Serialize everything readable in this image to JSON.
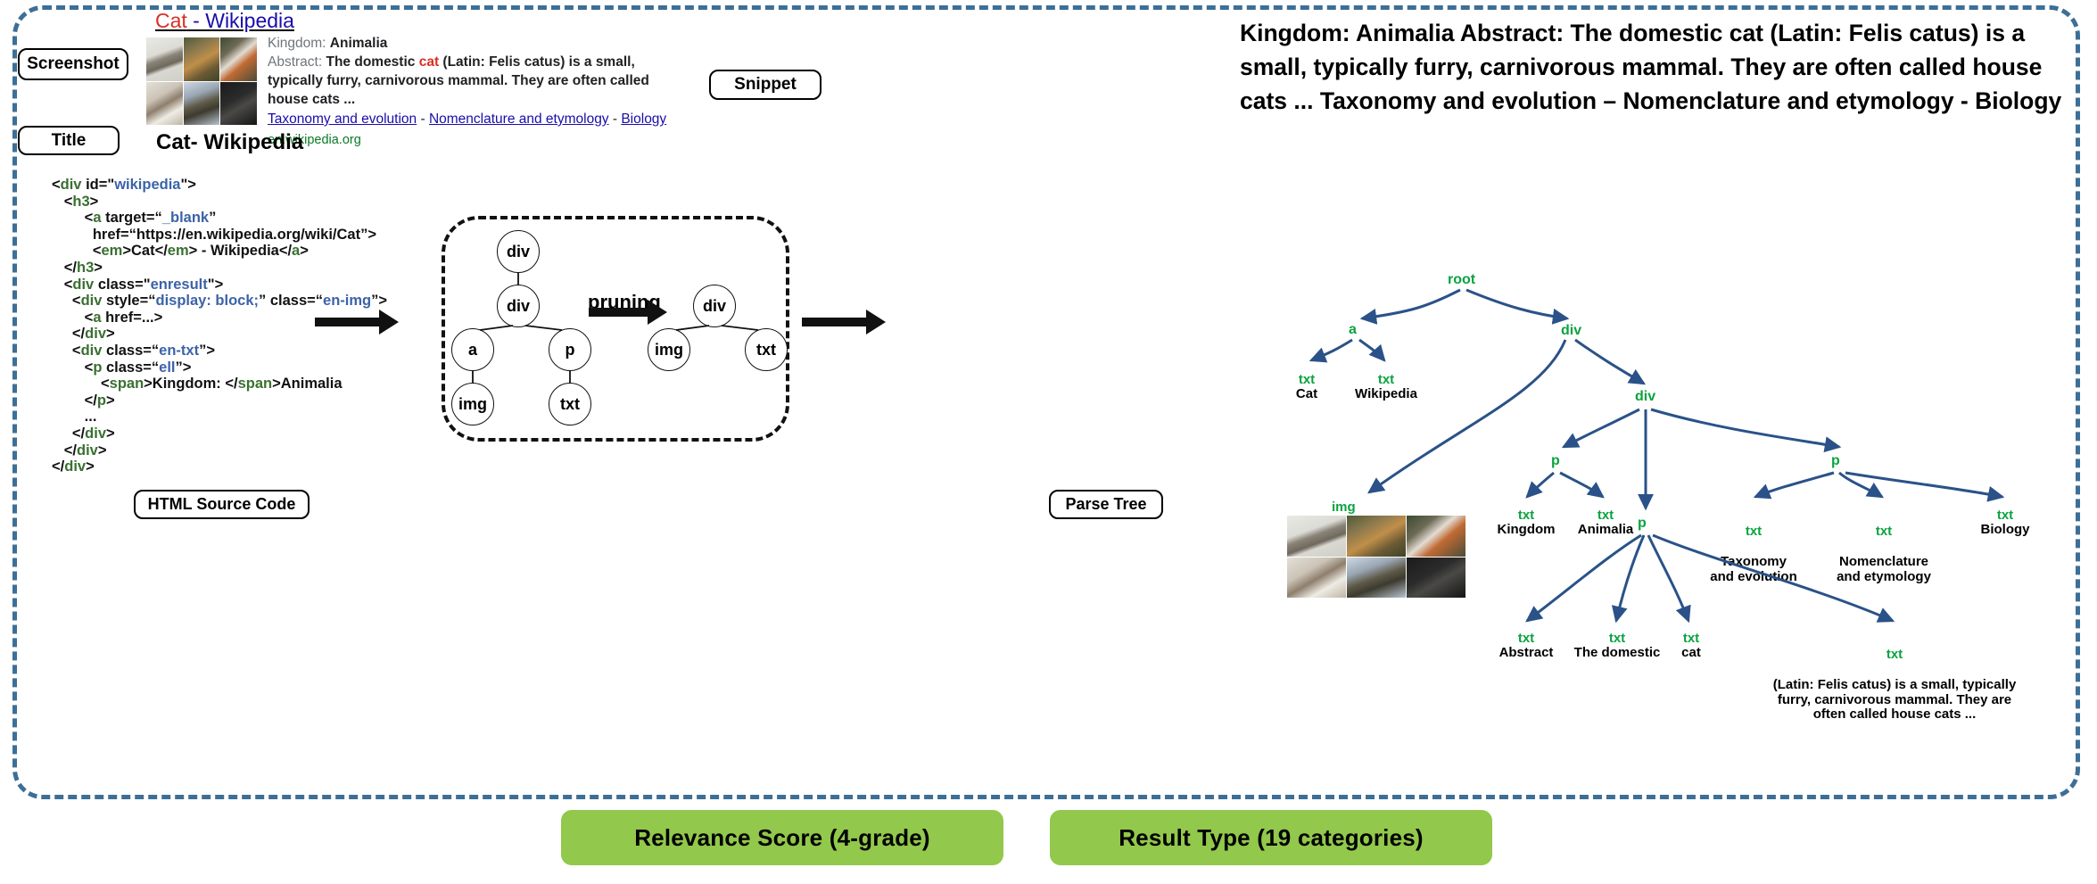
{
  "figure": {
    "outer_border_color": "#3d6f96",
    "accent_green": "#92c84b",
    "tree_node_color": "#0aa33f",
    "tree_edge_color": "#2a5288"
  },
  "labels": {
    "screenshot": "Screenshot",
    "title": "Title",
    "snippet": "Snippet",
    "html_source_code": "HTML Source Code",
    "parse_tree": "Parse Tree",
    "pruning": "pruning"
  },
  "serp": {
    "title_query": "Cat",
    "title_rest": " - Wikipedia",
    "kingdom_label": "Kingdom:",
    "kingdom_value": "Animalia",
    "abstract_label": "Abstract:",
    "abstract_pre": "The domestic ",
    "abstract_hl": "cat",
    "abstract_post": " (Latin: Felis catus) is a small, typically furry, carnivorous mammal. They are often called house cats ...",
    "sublinks": [
      "Taxonomy and evolution",
      "Nomenclature and etymology",
      "Biology"
    ],
    "sublink_separator": " - ",
    "url": "en.wikipedia.org"
  },
  "title_field": {
    "value": "Cat- Wikipedia"
  },
  "snippet_field": {
    "text": "Kingdom: Animalia Abstract: The domestic cat (Latin: Felis catus) is a small, typically furry, carnivorous mammal. They are often called house cats ...   Taxonomy and evolution – Nomenclature and etymology  - Biology"
  },
  "html_source": {
    "lines": [
      [
        [
          "pln",
          "<"
        ],
        [
          "tag",
          "div"
        ],
        [
          "pln",
          " id=\""
        ],
        [
          "val",
          "wikipedia"
        ],
        [
          "pln",
          "\">"
        ]
      ],
      [
        [
          "pln",
          "   <"
        ],
        [
          "tag",
          "h3"
        ],
        [
          "pln",
          ">"
        ]
      ],
      [
        [
          "pln",
          "        <"
        ],
        [
          "tag",
          "a"
        ],
        [
          "pln",
          " target=“"
        ],
        [
          "val",
          "_blank"
        ],
        [
          "pln",
          "”"
        ]
      ],
      [
        [
          "pln",
          "          href=“https://en.wikipedia.org/wiki/Cat”>"
        ]
      ],
      [
        [
          "pln",
          "          <"
        ],
        [
          "tag",
          "em"
        ],
        [
          "pln",
          ">Cat</"
        ],
        [
          "tag",
          "em"
        ],
        [
          "pln",
          "> - Wikipedia</"
        ],
        [
          "tag",
          "a"
        ],
        [
          "pln",
          ">"
        ]
      ],
      [
        [
          "pln",
          "   </"
        ],
        [
          "tag",
          "h3"
        ],
        [
          "pln",
          ">"
        ]
      ],
      [
        [
          "pln",
          "   <"
        ],
        [
          "tag",
          "div"
        ],
        [
          "pln",
          " class=\""
        ],
        [
          "val",
          "enresult"
        ],
        [
          "pln",
          "\">"
        ]
      ],
      [
        [
          "pln",
          "     <"
        ],
        [
          "tag",
          "div"
        ],
        [
          "pln",
          " style=“"
        ],
        [
          "val",
          "display: block;"
        ],
        [
          "pln",
          "” class=“"
        ],
        [
          "val",
          "en-img"
        ],
        [
          "pln",
          "”>"
        ]
      ],
      [
        [
          "pln",
          "        <"
        ],
        [
          "tag",
          "a"
        ],
        [
          "pln",
          " href=...>"
        ]
      ],
      [
        [
          "pln",
          "     </"
        ],
        [
          "tag",
          "div"
        ],
        [
          "pln",
          ">"
        ]
      ],
      [
        [
          "pln",
          "     <"
        ],
        [
          "tag",
          "div"
        ],
        [
          "pln",
          " class=“"
        ],
        [
          "val",
          "en-txt"
        ],
        [
          "pln",
          "”>"
        ]
      ],
      [
        [
          "pln",
          "        <"
        ],
        [
          "tag",
          "p"
        ],
        [
          "pln",
          " class=“"
        ],
        [
          "val",
          "ell"
        ],
        [
          "pln",
          "”>"
        ]
      ],
      [
        [
          "pln",
          "            <"
        ],
        [
          "tag",
          "span"
        ],
        [
          "pln",
          ">Kingdom: </"
        ],
        [
          "tag",
          "span"
        ],
        [
          "pln",
          ">Animalia"
        ]
      ],
      [
        [
          "pln",
          "        </"
        ],
        [
          "tag",
          "p"
        ],
        [
          "pln",
          ">"
        ]
      ],
      [
        [
          "pln",
          "        ..."
        ]
      ],
      [
        [
          "pln",
          "     </"
        ],
        [
          "tag",
          "div"
        ],
        [
          "pln",
          ">"
        ]
      ],
      [
        [
          "pln",
          "   </"
        ],
        [
          "tag",
          "div"
        ],
        [
          "pln",
          ">"
        ]
      ],
      [
        [
          "pln",
          "</"
        ],
        [
          "tag",
          "div"
        ],
        [
          "pln",
          ">"
        ]
      ]
    ]
  },
  "pruning_diagram": {
    "before_nodes": [
      "div",
      "div",
      "a",
      "p",
      "img",
      "txt"
    ],
    "after_nodes": [
      "div",
      "img",
      "txt"
    ]
  },
  "parse_tree": {
    "nodes": {
      "root": "root",
      "a": "a",
      "div1": "div",
      "div2": "div",
      "div3": "div",
      "p1": "p",
      "p2": "p",
      "p3": "p",
      "img": "img",
      "txt": "txt"
    },
    "leaves": [
      {
        "kind": "txt",
        "value": "Cat"
      },
      {
        "kind": "txt",
        "value": "Wikipedia"
      },
      {
        "kind": "txt",
        "value": "Kingdom"
      },
      {
        "kind": "txt",
        "value": "Animalia"
      },
      {
        "kind": "txt",
        "value": "Taxonomy\nand evolution"
      },
      {
        "kind": "txt",
        "value": "Nomenclature\nand etymology"
      },
      {
        "kind": "txt",
        "value": "Biology"
      },
      {
        "kind": "txt",
        "value": "Abstract"
      },
      {
        "kind": "txt",
        "value": "The domestic"
      },
      {
        "kind": "txt",
        "value": "cat"
      },
      {
        "kind": "txt",
        "value": "(Latin: Felis catus) is a small, typically\nfurry, carnivorous mammal. They are\noften called house cats ..."
      }
    ]
  },
  "outputs": {
    "relevance": "Relevance Score (4-grade)",
    "result_type": "Result Type (19 categories)"
  }
}
